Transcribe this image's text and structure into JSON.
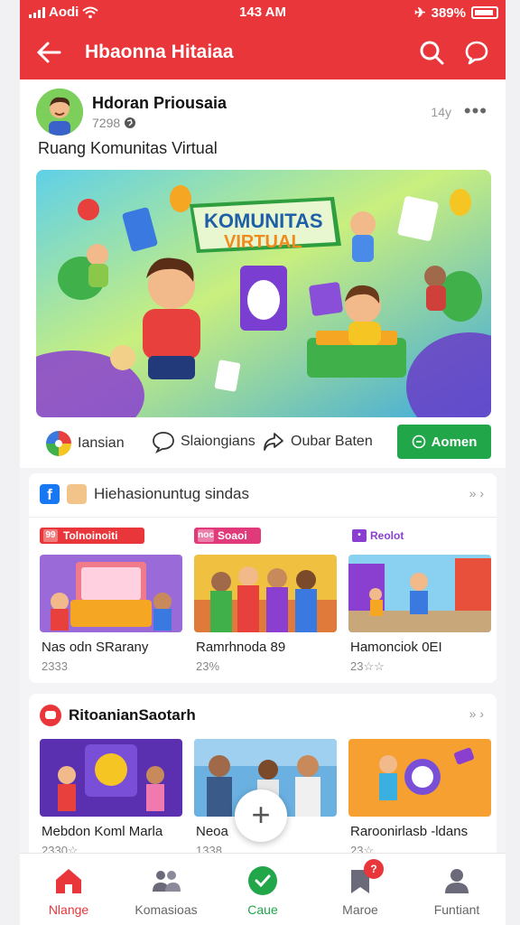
{
  "status_bar": {
    "carrier": "Aodi",
    "time": "143 AM",
    "battery": "389%"
  },
  "app_bar": {
    "title": "Hbaonna Hitaiaa"
  },
  "post": {
    "author": "Hdoran Priousaia",
    "meta": "7298",
    "time": "14y",
    "caption": "Ruang Komunitas Virtual",
    "banner_title_1": "KOMUNITAS",
    "banner_title_2": "VIRTUAL",
    "actions": {
      "react": "Iansian",
      "comment": "Slaiongians",
      "share": "Oubar Baten",
      "primary": "Aomen"
    }
  },
  "section1": {
    "title": "Hiehasionuntug sindas",
    "more": "»",
    "cards": [
      {
        "badge": "Tolnoinoiti",
        "badge_icon": "99",
        "badge_color": "#e9363a",
        "title": "Nas odn SRarany",
        "meta": "2333"
      },
      {
        "badge": "Soaoi",
        "badge_icon": "noc",
        "badge_color": "#e13a7a",
        "title": "Ramrhnoda 89",
        "meta": "23%"
      },
      {
        "badge": "Reolot",
        "badge_icon": "•",
        "badge_color": "#8b3fd0",
        "title": "Hamonciok 0EI",
        "meta": "23☆☆"
      }
    ]
  },
  "section2": {
    "title": "RitoanianSaotarh",
    "more": "»",
    "cards": [
      {
        "title": "Mebdon Koml Marla",
        "meta": "2330☆"
      },
      {
        "title": "Neoa",
        "meta": "1338"
      },
      {
        "title": "Raroonirlasb -ldans",
        "meta": "23☆"
      }
    ]
  },
  "nav": {
    "items": [
      {
        "label": "Nlange",
        "active": true
      },
      {
        "label": "Komasioas",
        "active": false
      },
      {
        "label": "Caue",
        "active": false
      },
      {
        "label": "Maroe",
        "active": false
      },
      {
        "label": "Funtiant",
        "active": false
      }
    ],
    "notification_badge": "?"
  },
  "colors": {
    "brand": "#e9363a",
    "accent": "#22a64a",
    "active_nav": "#e9363a"
  }
}
